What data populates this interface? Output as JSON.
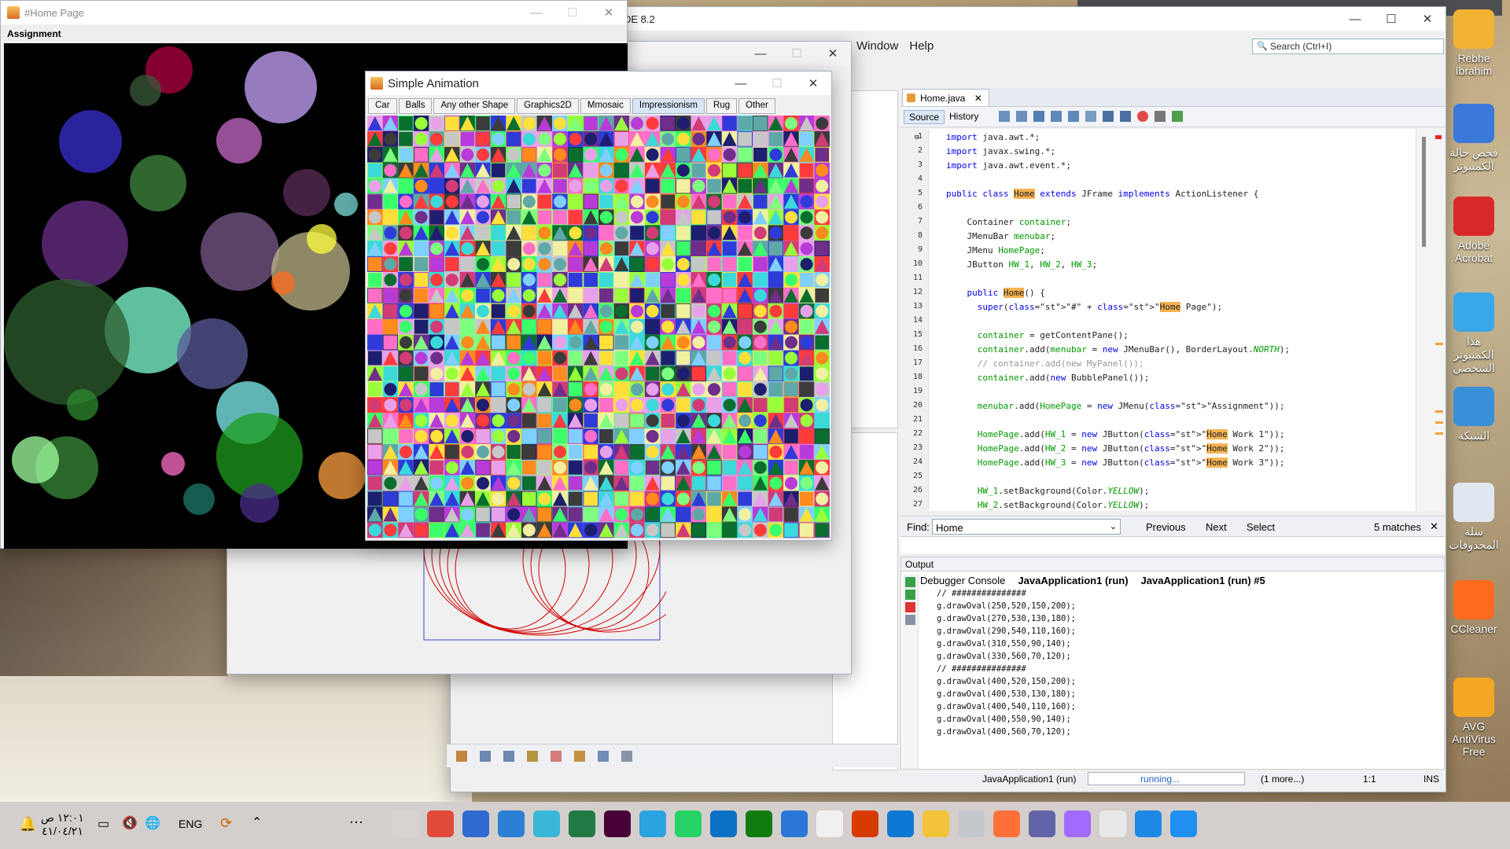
{
  "netbeans": {
    "title_fragment": "DE 8.2",
    "menu": [
      "Window",
      "Help"
    ],
    "search_placeholder": "Search (Ctrl+I)",
    "editor_tab": "Home.java",
    "editor_subtabs": [
      "Source",
      "History"
    ],
    "code_lines": [
      {
        "n": "1",
        "t": "import java.awt.*;"
      },
      {
        "n": "2",
        "t": "import javax.swing.*;"
      },
      {
        "n": "3",
        "t": "import java.awt.event.*;"
      },
      {
        "n": "4",
        "t": ""
      },
      {
        "n": "5",
        "t": "public class Home extends JFrame implements ActionListener {"
      },
      {
        "n": "6",
        "t": ""
      },
      {
        "n": "7",
        "t": "    Container container;"
      },
      {
        "n": "8",
        "t": "    JMenuBar menubar;"
      },
      {
        "n": "9",
        "t": "    JMenu HomePage;"
      },
      {
        "n": "10",
        "t": "    JButton HW_1, HW_2, HW_3;"
      },
      {
        "n": "11",
        "t": ""
      },
      {
        "n": "12",
        "t": "    public Home() {"
      },
      {
        "n": "13",
        "t": "      super(\"#\" + \"Home Page\");"
      },
      {
        "n": "14",
        "t": ""
      },
      {
        "n": "15",
        "t": "      container = getContentPane();"
      },
      {
        "n": "16",
        "t": "      container.add(menubar = new JMenuBar(), BorderLayout.NORTH);"
      },
      {
        "n": "17",
        "t": "      // container.add(new MyPanel());"
      },
      {
        "n": "18",
        "t": "      container.add(new BubblePanel());"
      },
      {
        "n": "19",
        "t": ""
      },
      {
        "n": "20",
        "t": "      menubar.add(HomePage = new JMenu(\"Assignment\"));"
      },
      {
        "n": "21",
        "t": ""
      },
      {
        "n": "22",
        "t": "      HomePage.add(HW_1 = new JButton(\"Home Work 1\"));"
      },
      {
        "n": "23",
        "t": "      HomePage.add(HW_2 = new JButton(\"Home Work 2\"));"
      },
      {
        "n": "24",
        "t": "      HomePage.add(HW_3 = new JButton(\"Home Work 3\"));"
      },
      {
        "n": "25",
        "t": ""
      },
      {
        "n": "26",
        "t": "      HW_1.setBackground(Color.YELLOW);"
      },
      {
        "n": "27",
        "t": "      HW_2.setBackground(Color.YELLOW);"
      }
    ],
    "find": {
      "label": "Find:",
      "value": "Home",
      "previous": "Previous",
      "next": "Next",
      "select": "Select",
      "matches": "5 matches"
    },
    "output": {
      "panel_title": "Output",
      "tabs": [
        "Debugger Console",
        "JavaApplication1 (run)",
        "JavaApplication1 (run) #5"
      ],
      "lines": [
        "// ###############",
        "g.drawOval(250,520,150,200);",
        "g.drawOval(270,530,130,180);",
        "g.drawOval(290,540,110,160);",
        "g.drawOval(310,550,90,140);",
        "g.drawOval(330,560,70,120);",
        "// ###############",
        "g.drawOval(400,520,150,200);",
        "g.drawOval(400,530,130,180);",
        "g.drawOval(400,540,110,160);",
        "g.drawOval(400,550,90,140);",
        "g.drawOval(400,560,70,120);"
      ]
    },
    "status": {
      "project": "JavaApplication1 (run)",
      "state": "running...",
      "more": "(1 more...)",
      "pos": "1:1",
      "mode": "INS"
    }
  },
  "home_window": {
    "title": "#Home Page",
    "menu": "Assignment"
  },
  "anim_window": {
    "title": "Simple Animation",
    "tabs": [
      "Car",
      "Balls",
      "Any other Shape",
      "Graphics2D",
      "Mmosaic",
      "Impressionism",
      "Rug",
      "Other"
    ],
    "active_tab": "Impressionism"
  },
  "desktop_icons": [
    "Rebhe Ibrahim",
    "فحص حالة الكمبيوتر",
    "Adobe Acrobat",
    "هذا الكمبيوتر الشخصي",
    "الشبكة",
    "سلة المحذوفات",
    "CCleaner",
    "AVG AntiVirus Free"
  ],
  "taskbar": {
    "time": "١٢:٠١ ص",
    "date": "٤١/٠٤/٢١",
    "language": "ENG",
    "apps": [
      "Java",
      "Chrome",
      "Media",
      "VS Code",
      "Files",
      "Excel",
      "Xd",
      "Telegram",
      "WhatsApp",
      "Intel",
      "Xbox",
      "Mail",
      "Store",
      "Office",
      "Edge",
      "Explorer",
      "Calculator",
      "Firefox",
      "Teams",
      "Copilot",
      "Task View",
      "Search",
      "Windows"
    ]
  },
  "colors": {
    "java_keyword": "#0000e6",
    "java_field": "#009900",
    "java_string": "#ce7b00",
    "match_highlight": "#f6b451",
    "bubble_bg": "#000000"
  }
}
